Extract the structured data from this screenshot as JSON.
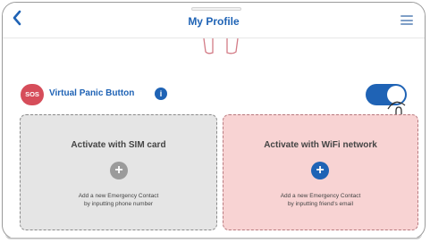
{
  "header": {
    "title": "My Profile",
    "back_icon": "chevron-left-icon",
    "menu_icon": "hamburger-menu-icon"
  },
  "panic": {
    "badge": "SOS",
    "label": "Virtual Panic Button",
    "info_icon": "i",
    "enabled": true
  },
  "cards": {
    "sim": {
      "title": "Activate with SIM card",
      "desc_line1": "Add a new Emergency Contact",
      "desc_line2": "by inputting phone number",
      "icon": "+"
    },
    "wifi": {
      "title": "Activate with WiFi network",
      "desc_line1": "Add a new Emergency Contact",
      "desc_line2": "by inputting friend's email",
      "icon": "+"
    }
  },
  "colors": {
    "accent": "#1f63b5",
    "sos": "#d64d5a",
    "sim_card_bg": "#e5e5e5",
    "wifi_card_bg": "#f8d3d3"
  }
}
